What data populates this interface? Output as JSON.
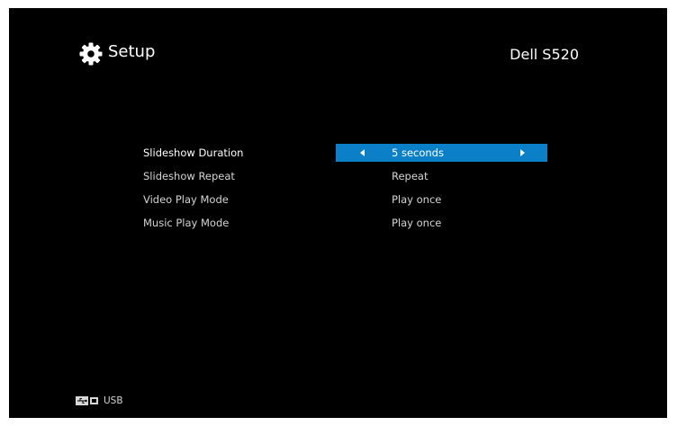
{
  "header": {
    "title": "Setup",
    "icon": "gear-icon",
    "model": "Dell S520"
  },
  "menu": {
    "items": [
      {
        "label": "Slideshow Duration",
        "value": "5 seconds",
        "selected": true
      },
      {
        "label": "Slideshow Repeat",
        "value": "Repeat",
        "selected": false
      },
      {
        "label": "Video Play Mode",
        "value": "Play once",
        "selected": false
      },
      {
        "label": "Music Play Mode",
        "value": "Play once",
        "selected": false
      }
    ]
  },
  "footer": {
    "source_label": "USB",
    "source_icon": "usb-icon"
  },
  "colors": {
    "background": "#000000",
    "highlight": "#0b7fc8",
    "text": "#ffffff"
  }
}
